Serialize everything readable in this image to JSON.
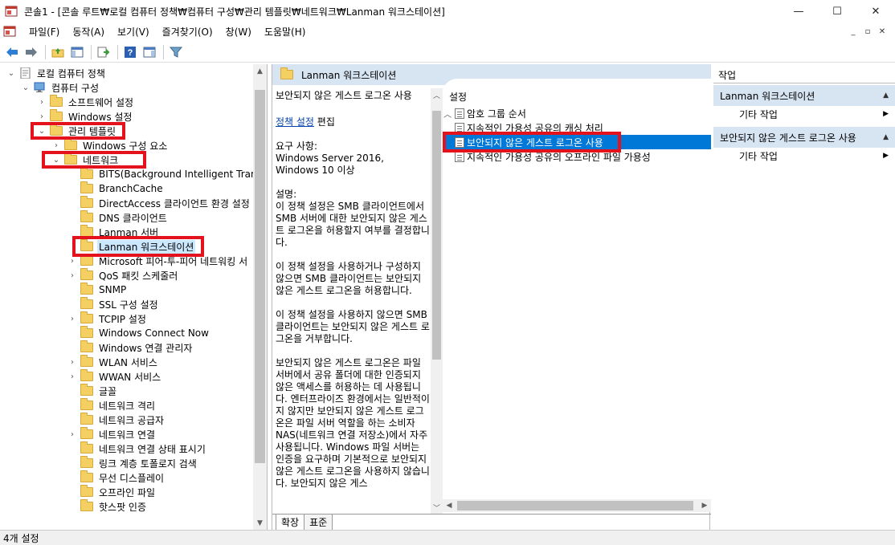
{
  "window": {
    "title": "콘솔1 - [콘솔 루트₩로컬 컴퓨터 정책₩컴퓨터 구성₩관리 템플릿₩네트워크₩Lanman 워크스테이션]",
    "minimize": "—",
    "maximize": "☐",
    "close": "✕"
  },
  "menu": [
    "파일(F)",
    "동작(A)",
    "보기(V)",
    "즐겨찾기(O)",
    "창(W)",
    "도움말(H)"
  ],
  "mdi": {
    "minimize": "_",
    "restore": "▫",
    "close": "✕"
  },
  "tree": {
    "items": [
      {
        "label": "로컬 컴퓨터 정책",
        "chev": "⌄"
      },
      {
        "label": "컴퓨터 구성",
        "chev": "⌄"
      },
      {
        "label": "소프트웨어 설정",
        "chev": "›"
      },
      {
        "label": "Windows 설정",
        "chev": "›"
      },
      {
        "label": "관리 템플릿",
        "chev": "⌄"
      },
      {
        "label": "Windows 구성 요소",
        "chev": "›"
      },
      {
        "label": "네트워크",
        "chev": "⌄"
      },
      {
        "label": "BITS(Background Intelligent Transfer",
        "chev": ""
      },
      {
        "label": "BranchCache",
        "chev": ""
      },
      {
        "label": "DirectAccess 클라이언트 환경 설정",
        "chev": ""
      },
      {
        "label": "DNS 클라이언트",
        "chev": ""
      },
      {
        "label": "Lanman 서버",
        "chev": ""
      },
      {
        "label": "Lanman 워크스테이션",
        "chev": ""
      },
      {
        "label": "Microsoft 피어-투-피어 네트워킹 서",
        "chev": "›"
      },
      {
        "label": "QoS 패킷 스케줄러",
        "chev": "›"
      },
      {
        "label": "SNMP",
        "chev": ""
      },
      {
        "label": "SSL 구성 설정",
        "chev": ""
      },
      {
        "label": "TCPIP 설정",
        "chev": "›"
      },
      {
        "label": "Windows Connect Now",
        "chev": ""
      },
      {
        "label": "Windows 연결 관리자",
        "chev": ""
      },
      {
        "label": "WLAN 서비스",
        "chev": "›"
      },
      {
        "label": "WWAN 서비스",
        "chev": "›"
      },
      {
        "label": "글꼴",
        "chev": ""
      },
      {
        "label": "네트워크 격리",
        "chev": ""
      },
      {
        "label": "네트워크 공급자",
        "chev": ""
      },
      {
        "label": "네트워크 연결",
        "chev": "›"
      },
      {
        "label": "네트워크 연결 상태 표시기",
        "chev": ""
      },
      {
        "label": "링크 계층 토폴로지 검색",
        "chev": ""
      },
      {
        "label": "무선 디스플레이",
        "chev": ""
      },
      {
        "label": "오프라인 파일",
        "chev": ""
      },
      {
        "label": "핫스팟 인증",
        "chev": ""
      }
    ]
  },
  "middle": {
    "header": "Lanman 워크스테이션",
    "desc_title": "보안되지 않은 게스트 로그온 사용",
    "desc_link": "정책 설정",
    "desc_edit": " 편집",
    "desc_req": "요구 사항:\nWindows Server 2016, Windows 10 이상",
    "desc_p1": "설명:\n이 정책 설정은 SMB 클라이언트에서 SMB 서버에 대한 보안되지 않은 게스트 로그온을 허용할지 여부를 결정합니다.",
    "desc_p2": "이 정책 설정을 사용하거나 구성하지 않으면 SMB 클라이언트는 보안되지 않은 게스트 로그온을 허용합니다.",
    "desc_p3": "이 정책 설정을 사용하지 않으면 SMB 클라이언트는 보안되지 않은 게스트 로그온을 거부합니다.",
    "desc_p4": "보안되지 않은 게스트 로그온은 파일 서버에서 공유 폴더에 대한 인증되지 않은 액세스를 허용하는 데 사용됩니다. 엔터프라이즈 환경에서는 일반적이지 않지만 보안되지 않은 게스트 로그온은 파일 서버 역할을 하는 소비자 NAS(네트워크 연결 저장소)에서 자주 사용됩니다. Windows 파일 서버는 인증을 요구하며 기본적으로 보안되지 않은 게스트 로그온을 사용하지 않습니다. 보안되지 않은 게스",
    "settings_head": "설정",
    "settings": [
      {
        "label": "암호 그룹 순서"
      },
      {
        "label": "지속적인 가용성 공유의 캐싱 처리"
      },
      {
        "label": "보안되지 않은 게스트 로그온 사용"
      },
      {
        "label": "지속적인 가용성 공유의 오프라인 파일 가용성"
      }
    ],
    "tabs": [
      "확장",
      "표준"
    ]
  },
  "actions": {
    "head": "작업",
    "sections": [
      {
        "title": "Lanman 워크스테이션",
        "item": "기타 작업"
      },
      {
        "title": "보안되지 않은 게스트 로그온 사용",
        "item": "기타 작업"
      }
    ]
  },
  "status": "4개 설정"
}
